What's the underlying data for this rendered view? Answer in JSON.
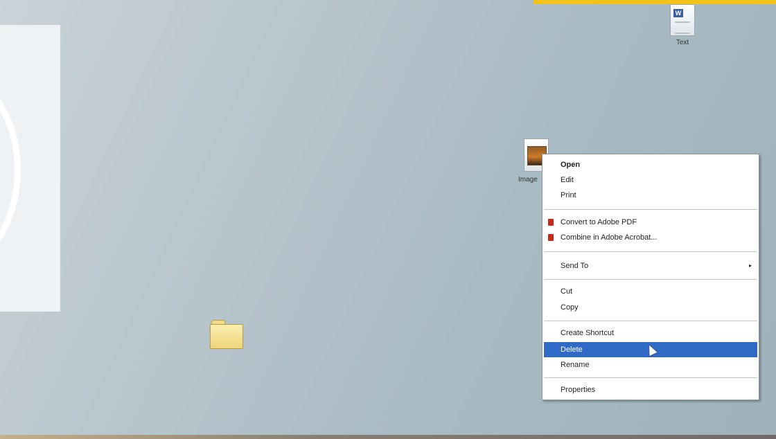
{
  "desktop": {
    "icons": {
      "text_doc": {
        "label": "Text",
        "badge": "W"
      },
      "image_file": {
        "label": "Image"
      },
      "folder": {
        "label": ""
      }
    }
  },
  "context_menu": {
    "items": [
      {
        "label": "Open",
        "bold": true
      },
      {
        "label": "Edit"
      },
      {
        "label": "Print"
      },
      {
        "label": "Convert to Adobe PDF",
        "icon": "pdf-icon"
      },
      {
        "label": "Combine in Adobe Acrobat...",
        "icon": "pdf-icon"
      },
      {
        "label": "Send To",
        "submenu_indicator": "▸"
      },
      {
        "label": "Cut"
      },
      {
        "label": "Copy"
      },
      {
        "label": "Create Shortcut"
      },
      {
        "label": "Delete",
        "selected": true
      },
      {
        "label": "Rename"
      },
      {
        "label": "Properties"
      }
    ]
  },
  "colors": {
    "selection": "#3169c6",
    "banner": "#f3c21b"
  }
}
